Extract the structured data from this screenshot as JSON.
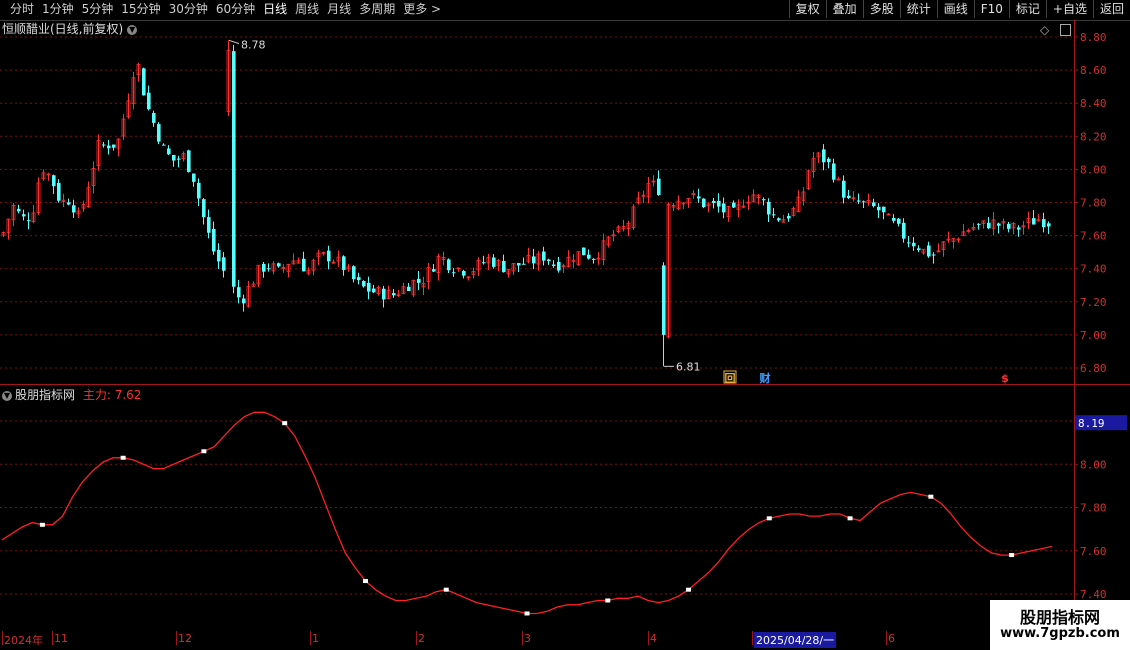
{
  "toolbar": {
    "periods": [
      "分时",
      "1分钟",
      "5分钟",
      "15分钟",
      "30分钟",
      "60分钟",
      "日线",
      "周线",
      "月线",
      "多周期",
      "更多 >"
    ],
    "active_period": "日线",
    "actions": [
      "复权",
      "叠加",
      "多股",
      "统计",
      "画线",
      "F10",
      "标记",
      "+自选",
      "返回"
    ]
  },
  "main_panel": {
    "title": "恒顺醋业(日线,前复权)",
    "high_label": "8.78",
    "low_label": "6.81",
    "price_ticks": [
      "8.80",
      "8.60",
      "8.40",
      "8.20",
      "8.00",
      "7.80",
      "7.60",
      "7.40",
      "7.20",
      "7.00",
      "6.80"
    ],
    "events": [
      {
        "icon": "回",
        "color": "#e8b040"
      },
      {
        "icon": "财",
        "color": "#40a0ff"
      },
      {
        "icon": "$",
        "color": "#ff3030"
      }
    ]
  },
  "indicator_panel": {
    "name": "股朋指标网",
    "series_label": "主力: 7.62",
    "current_value": "8.19",
    "ticks": [
      "8.20",
      "8.00",
      "7.80",
      "7.60",
      "7.40"
    ]
  },
  "time_axis": {
    "labels": [
      "2024年",
      "11",
      "12",
      "1",
      "2",
      "3",
      "4",
      "2025/04/28/一",
      "6"
    ]
  },
  "watermark": {
    "title": "股朋指标网",
    "url": "www.7gpzb.com"
  },
  "colors": {
    "up": "#ff3030",
    "down": "#54ffff",
    "line": "#ff2020",
    "grid": "#7a1010"
  },
  "chart_data": {
    "type": "candlestick",
    "price_range": [
      6.78,
      8.85
    ],
    "indicator_range": [
      7.33,
      8.3
    ],
    "indicator_series": {
      "name": "主力",
      "values": [
        7.65,
        7.68,
        7.71,
        7.73,
        7.72,
        7.72,
        7.76,
        7.85,
        7.92,
        7.97,
        8.01,
        8.03,
        8.03,
        8.02,
        8.0,
        7.98,
        7.98,
        8.0,
        8.02,
        8.04,
        8.06,
        8.08,
        8.13,
        8.18,
        8.22,
        8.24,
        8.24,
        8.22,
        8.19,
        8.13,
        8.04,
        7.94,
        7.82,
        7.7,
        7.59,
        7.52,
        7.46,
        7.42,
        7.39,
        7.37,
        7.37,
        7.38,
        7.39,
        7.41,
        7.42,
        7.4,
        7.38,
        7.36,
        7.35,
        7.34,
        7.33,
        7.32,
        7.31,
        7.31,
        7.32,
        7.34,
        7.35,
        7.35,
        7.36,
        7.37,
        7.37,
        7.38,
        7.38,
        7.39,
        7.37,
        7.36,
        7.37,
        7.39,
        7.42,
        7.46,
        7.5,
        7.55,
        7.61,
        7.66,
        7.7,
        7.73,
        7.75,
        7.76,
        7.77,
        7.77,
        7.76,
        7.76,
        7.77,
        7.77,
        7.75,
        7.74,
        7.78,
        7.82,
        7.84,
        7.86,
        7.87,
        7.86,
        7.85,
        7.82,
        7.77,
        7.71,
        7.66,
        7.62,
        7.59,
        7.58,
        7.58,
        7.59,
        7.6,
        7.61,
        7.62
      ]
    },
    "candles": []
  }
}
